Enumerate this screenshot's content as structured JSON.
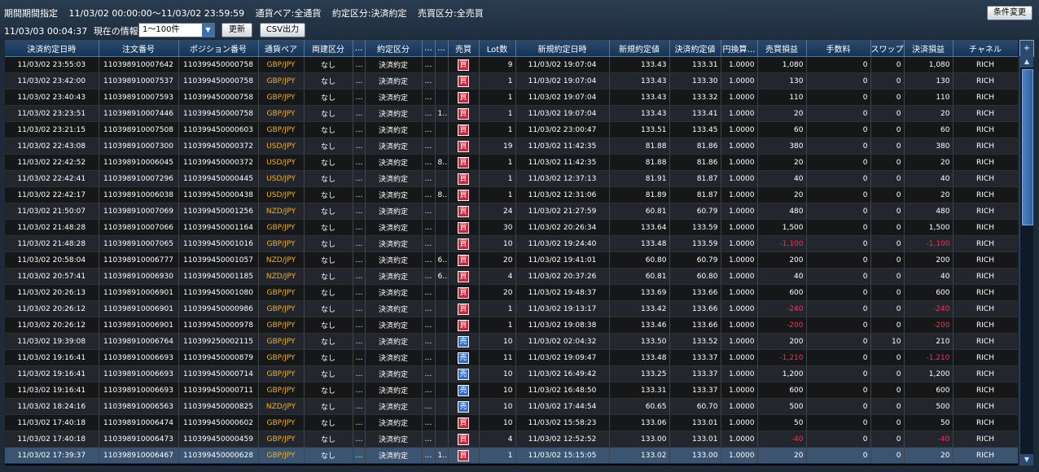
{
  "header": {
    "period_label": "期間期間指定",
    "period_range": "11/03/02 00:00:00～11/03/02 23:59:59",
    "currency_filter": "通貨ペア:全通貨",
    "trade_filter": "約定区分:決済約定",
    "side_filter": "売買区分:全売買",
    "change_conditions_button": "条件変更",
    "timestamp": "11/03/03 00:04:37",
    "current_info_label": "現在の情報",
    "range_select_value": "1～100件",
    "update_button": "更新",
    "csv_button": "CSV出力"
  },
  "table": {
    "columns": [
      "決済約定日時",
      "注文番号",
      "ポジション番号",
      "通貨ペア",
      "両建区分",
      "…",
      "約定区分",
      "…",
      "…",
      "売買",
      "Lot数",
      "新規約定日時",
      "新規約定値",
      "決済約定値",
      "円換算…",
      "売買損益",
      "手数料",
      "スワップ損益",
      "決済損益",
      "チャネル"
    ],
    "rows": [
      [
        "11/03/02 23:55:03",
        "110398910007642",
        "110399450000758",
        "GBP/JPY",
        "なし",
        "…",
        "決済約定",
        "…",
        "",
        "買",
        "9",
        "11/03/02 19:07:04",
        "133.43",
        "133.31",
        "1.0000",
        "1,080",
        "0",
        "0",
        "1,080",
        "RICH"
      ],
      [
        "11/03/02 23:42:00",
        "110398910007537",
        "110399450000758",
        "GBP/JPY",
        "なし",
        "…",
        "決済約定",
        "…",
        "",
        "買",
        "1",
        "11/03/02 19:07:04",
        "133.43",
        "133.30",
        "1.0000",
        "130",
        "0",
        "0",
        "130",
        "RICH"
      ],
      [
        "11/03/02 23:40:43",
        "110398910007593",
        "110399450000758",
        "GBP/JPY",
        "なし",
        "…",
        "決済約定",
        "…",
        "",
        "買",
        "1",
        "11/03/02 19:07:04",
        "133.43",
        "133.32",
        "1.0000",
        "110",
        "0",
        "0",
        "110",
        "RICH"
      ],
      [
        "11/03/02 23:23:51",
        "110398910007446",
        "110399450000758",
        "GBP/JPY",
        "なし",
        "…",
        "決済約定",
        "…",
        "1…",
        "買",
        "1",
        "11/03/02 19:07:04",
        "133.43",
        "133.41",
        "1.0000",
        "20",
        "0",
        "0",
        "20",
        "RICH"
      ],
      [
        "11/03/02 23:21:15",
        "110398910007508",
        "110399450000603",
        "GBP/JPY",
        "なし",
        "…",
        "決済約定",
        "…",
        "",
        "買",
        "1",
        "11/03/02 23:00:47",
        "133.51",
        "133.45",
        "1.0000",
        "60",
        "0",
        "0",
        "60",
        "RICH"
      ],
      [
        "11/03/02 22:43:08",
        "110398910007300",
        "110399450000372",
        "USD/JPY",
        "なし",
        "…",
        "決済約定",
        "…",
        "",
        "買",
        "19",
        "11/03/02 11:42:35",
        "81.88",
        "81.86",
        "1.0000",
        "380",
        "0",
        "0",
        "380",
        "RICH"
      ],
      [
        "11/03/02 22:42:52",
        "110398910006045",
        "110399450000372",
        "USD/JPY",
        "なし",
        "…",
        "決済約定",
        "…",
        "8…",
        "買",
        "1",
        "11/03/02 11:42:35",
        "81.88",
        "81.86",
        "1.0000",
        "20",
        "0",
        "0",
        "20",
        "RICH"
      ],
      [
        "11/03/02 22:42:41",
        "110398910007296",
        "110399450000445",
        "USD/JPY",
        "なし",
        "…",
        "決済約定",
        "…",
        "",
        "買",
        "1",
        "11/03/02 12:37:13",
        "81.91",
        "81.87",
        "1.0000",
        "40",
        "0",
        "0",
        "40",
        "RICH"
      ],
      [
        "11/03/02 22:42:17",
        "110398910006038",
        "110399450000438",
        "USD/JPY",
        "なし",
        "…",
        "決済約定",
        "…",
        "8…",
        "買",
        "1",
        "11/03/02 12:31:06",
        "81.89",
        "81.87",
        "1.0000",
        "20",
        "0",
        "0",
        "20",
        "RICH"
      ],
      [
        "11/03/02 21:50:07",
        "110398910007069",
        "110399450001256",
        "NZD/JPY",
        "なし",
        "…",
        "決済約定",
        "…",
        "",
        "買",
        "24",
        "11/03/02 21:27:59",
        "60.81",
        "60.79",
        "1.0000",
        "480",
        "0",
        "0",
        "480",
        "RICH"
      ],
      [
        "11/03/02 21:48:28",
        "110398910007066",
        "110399450001164",
        "GBP/JPY",
        "なし",
        "…",
        "決済約定",
        "…",
        "",
        "買",
        "30",
        "11/03/02 20:26:34",
        "133.64",
        "133.59",
        "1.0000",
        "1,500",
        "0",
        "0",
        "1,500",
        "RICH"
      ],
      [
        "11/03/02 21:48:28",
        "110398910007065",
        "110399450001016",
        "GBP/JPY",
        "なし",
        "…",
        "決済約定",
        "…",
        "",
        "買",
        "10",
        "11/03/02 19:24:40",
        "133.48",
        "133.59",
        "1.0000",
        "-1,100",
        "0",
        "0",
        "-1,100",
        "RICH"
      ],
      [
        "11/03/02 20:58:04",
        "110398910006777",
        "110399450001057",
        "NZD/JPY",
        "なし",
        "…",
        "決済約定",
        "…",
        "6…",
        "買",
        "20",
        "11/03/02 19:41:01",
        "60.80",
        "60.79",
        "1.0000",
        "200",
        "0",
        "0",
        "200",
        "RICH"
      ],
      [
        "11/03/02 20:57:41",
        "110398910006930",
        "110399450001185",
        "NZD/JPY",
        "なし",
        "…",
        "決済約定",
        "…",
        "6…",
        "買",
        "4",
        "11/03/02 20:37:26",
        "60.81",
        "60.80",
        "1.0000",
        "40",
        "0",
        "0",
        "40",
        "RICH"
      ],
      [
        "11/03/02 20:26:13",
        "110398910006901",
        "110399450001080",
        "GBP/JPY",
        "なし",
        "…",
        "決済約定",
        "…",
        "",
        "買",
        "20",
        "11/03/02 19:48:37",
        "133.69",
        "133.66",
        "1.0000",
        "600",
        "0",
        "0",
        "600",
        "RICH"
      ],
      [
        "11/03/02 20:26:12",
        "110398910006901",
        "110399450000986",
        "GBP/JPY",
        "なし",
        "…",
        "決済約定",
        "…",
        "",
        "買",
        "1",
        "11/03/02 19:13:17",
        "133.42",
        "133.66",
        "1.0000",
        "-240",
        "0",
        "0",
        "-240",
        "RICH"
      ],
      [
        "11/03/02 20:26:12",
        "110398910006901",
        "110399450000978",
        "GBP/JPY",
        "なし",
        "…",
        "決済約定",
        "…",
        "",
        "買",
        "1",
        "11/03/02 19:08:38",
        "133.46",
        "133.66",
        "1.0000",
        "-200",
        "0",
        "0",
        "-200",
        "RICH"
      ],
      [
        "11/03/02 19:39:08",
        "110398910006764",
        "110399250002115",
        "GBP/JPY",
        "なし",
        "…",
        "決済約定",
        "…",
        "",
        "売",
        "10",
        "11/03/02 02:04:32",
        "133.50",
        "133.52",
        "1.0000",
        "200",
        "0",
        "10",
        "210",
        "RICH"
      ],
      [
        "11/03/02 19:16:41",
        "110398910006693",
        "110399450000879",
        "GBP/JPY",
        "なし",
        "…",
        "決済約定",
        "…",
        "",
        "売",
        "11",
        "11/03/02 19:09:47",
        "133.48",
        "133.37",
        "1.0000",
        "-1,210",
        "0",
        "0",
        "-1,210",
        "RICH"
      ],
      [
        "11/03/02 19:16:41",
        "110398910006693",
        "110399450000714",
        "GBP/JPY",
        "なし",
        "…",
        "決済約定",
        "…",
        "",
        "売",
        "10",
        "11/03/02 16:49:42",
        "133.25",
        "133.37",
        "1.0000",
        "1,200",
        "0",
        "0",
        "1,200",
        "RICH"
      ],
      [
        "11/03/02 19:16:41",
        "110398910006693",
        "110399450000711",
        "GBP/JPY",
        "なし",
        "…",
        "決済約定",
        "…",
        "",
        "売",
        "10",
        "11/03/02 16:48:50",
        "133.31",
        "133.37",
        "1.0000",
        "600",
        "0",
        "0",
        "600",
        "RICH"
      ],
      [
        "11/03/02 18:24:16",
        "110398910006563",
        "110399450000825",
        "NZD/JPY",
        "なし",
        "…",
        "決済約定",
        "…",
        "",
        "売",
        "10",
        "11/03/02 17:44:54",
        "60.65",
        "60.70",
        "1.0000",
        "500",
        "0",
        "0",
        "500",
        "RICH"
      ],
      [
        "11/03/02 17:40:18",
        "110398910006474",
        "110399450000602",
        "GBP/JPY",
        "なし",
        "…",
        "決済約定",
        "…",
        "",
        "買",
        "10",
        "11/03/02 15:58:23",
        "133.06",
        "133.01",
        "1.0000",
        "50",
        "0",
        "0",
        "50",
        "RICH"
      ],
      [
        "11/03/02 17:40:18",
        "110398910006473",
        "110399450000459",
        "GBP/JPY",
        "なし",
        "…",
        "決済約定",
        "…",
        "",
        "買",
        "4",
        "11/03/02 12:52:52",
        "133.00",
        "133.01",
        "1.0000",
        "-40",
        "0",
        "0",
        "-40",
        "RICH"
      ],
      [
        "11/03/02 17:39:37",
        "110398910006467",
        "110399450000628",
        "GBP/JPY",
        "なし",
        "…",
        "決済約定",
        "…",
        "1…",
        "買",
        "1",
        "11/03/02 15:15:05",
        "133.02",
        "133.00",
        "1.0000",
        "20",
        "0",
        "0",
        "20",
        "RICH"
      ]
    ],
    "selected_row": 24
  },
  "colors": {
    "pair": "#f0b020",
    "negative": "#ff2a55",
    "buy_badge": "#d0243a",
    "sell_badge": "#2e6fd0"
  }
}
